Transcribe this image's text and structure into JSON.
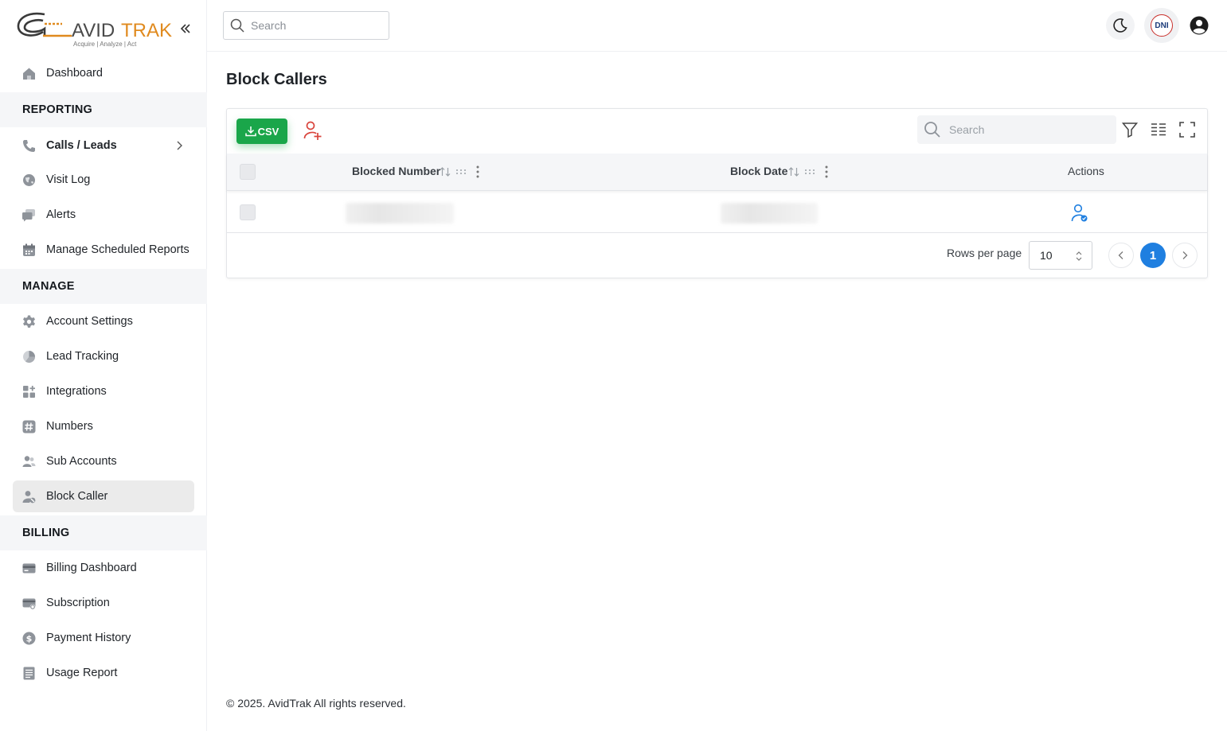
{
  "brand": {
    "name_prefix": "AVID",
    "name_suffix": "TRAK",
    "tagline": "Acquire | Analyze | Act",
    "accent_color": "#e08a1e"
  },
  "sidebar": {
    "dashboard": {
      "label": "Dashboard",
      "icon": "home-icon"
    },
    "sections": {
      "reporting": "REPORTING",
      "manage": "MANAGE",
      "billing": "BILLING"
    },
    "reporting_items": [
      {
        "label": "Calls / Leads",
        "icon": "phone-icon"
      },
      {
        "label": "Visit Log",
        "icon": "globe-icon"
      },
      {
        "label": "Alerts",
        "icon": "chat-icon"
      },
      {
        "label": "Manage Scheduled Reports",
        "icon": "calendar-icon"
      }
    ],
    "manage_items": [
      {
        "label": "Account Settings",
        "icon": "gear-icon"
      },
      {
        "label": "Lead Tracking",
        "icon": "pie-icon"
      },
      {
        "label": "Integrations",
        "icon": "grid-plus-icon"
      },
      {
        "label": "Numbers",
        "icon": "hash-icon"
      },
      {
        "label": "Sub Accounts",
        "icon": "users-icon"
      },
      {
        "label": "Block Caller",
        "icon": "user-block-icon"
      }
    ],
    "billing_items": [
      {
        "label": "Billing Dashboard",
        "icon": "card-icon"
      },
      {
        "label": "Subscription",
        "icon": "subscription-icon"
      },
      {
        "label": "Payment History",
        "icon": "dollar-icon"
      },
      {
        "label": "Usage Report",
        "icon": "report-icon"
      }
    ],
    "active_item": "Block Caller"
  },
  "header": {
    "search_placeholder": "Search",
    "dni_label": "DNI"
  },
  "main": {
    "page_title": "Block Callers",
    "toolbar": {
      "csv_label": "CSV",
      "search_placeholder": "Search"
    },
    "table": {
      "columns": [
        "Blocked Number",
        "Block Date",
        "Actions"
      ],
      "rows": [
        {
          "blocked_number": "",
          "block_date": ""
        }
      ]
    },
    "pagination": {
      "rows_per_page_label": "Rows per page",
      "rows_per_page_value": "10",
      "current_page": "1"
    }
  },
  "footer": {
    "text": "© 2025. AvidTrak All rights reserved."
  },
  "colors": {
    "csv_green": "#1aa64a",
    "add_user_red": "#d9443c",
    "action_blue": "#1f7fe0",
    "page_active": "#1f7fe0"
  }
}
